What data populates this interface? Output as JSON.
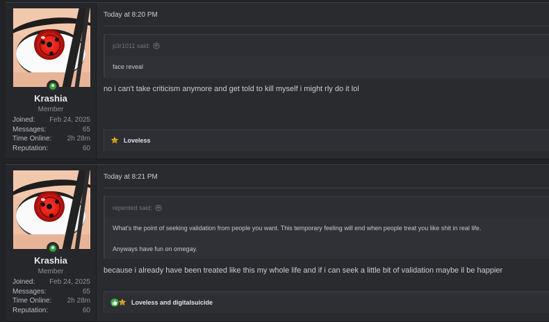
{
  "posts": [
    {
      "user": {
        "name": "Krashia",
        "title": "Member",
        "stats": [
          {
            "label": "Joined:",
            "value": "Feb 24, 2025"
          },
          {
            "label": "Messages:",
            "value": "65"
          },
          {
            "label": "Time Online:",
            "value": "2h 28m"
          },
          {
            "label": "Reputation:",
            "value": "60"
          }
        ]
      },
      "date": "Today at 8:20 PM",
      "quote": {
        "author": "p3r1011 said:",
        "lines": [
          "face reveal"
        ]
      },
      "message": "no i can't take criticism anymore and get told to kill myself i might rly do it lol",
      "reactions": {
        "icons": [
          "star-smiley-icon"
        ],
        "label": "Loveless"
      }
    },
    {
      "user": {
        "name": "Krashia",
        "title": "Member",
        "stats": [
          {
            "label": "Joined:",
            "value": "Feb 24, 2025"
          },
          {
            "label": "Messages:",
            "value": "65"
          },
          {
            "label": "Time Online:",
            "value": "2h 28m"
          },
          {
            "label": "Reputation:",
            "value": "60"
          }
        ]
      },
      "date": "Today at 8:21 PM",
      "quote": {
        "author": "repented said:",
        "lines": [
          "What's the point of seeking validation from people you want. This temporary feeling will end when people treat you like shit in real life.",
          "Anyways have fun on omegay."
        ]
      },
      "message": "because i already have been treated like this my whole life and if i can seek a little bit of validation maybe il be happier",
      "reactions": {
        "icons": [
          "thumbs-up-icon",
          "star-smiley-icon"
        ],
        "label": "Loveless and digitalsuicide"
      }
    }
  ],
  "colors": {
    "background": "#222326",
    "post": "#2a2b2f",
    "online": "#38a33b",
    "like": "#3ba84a",
    "star": "#f2c230"
  }
}
